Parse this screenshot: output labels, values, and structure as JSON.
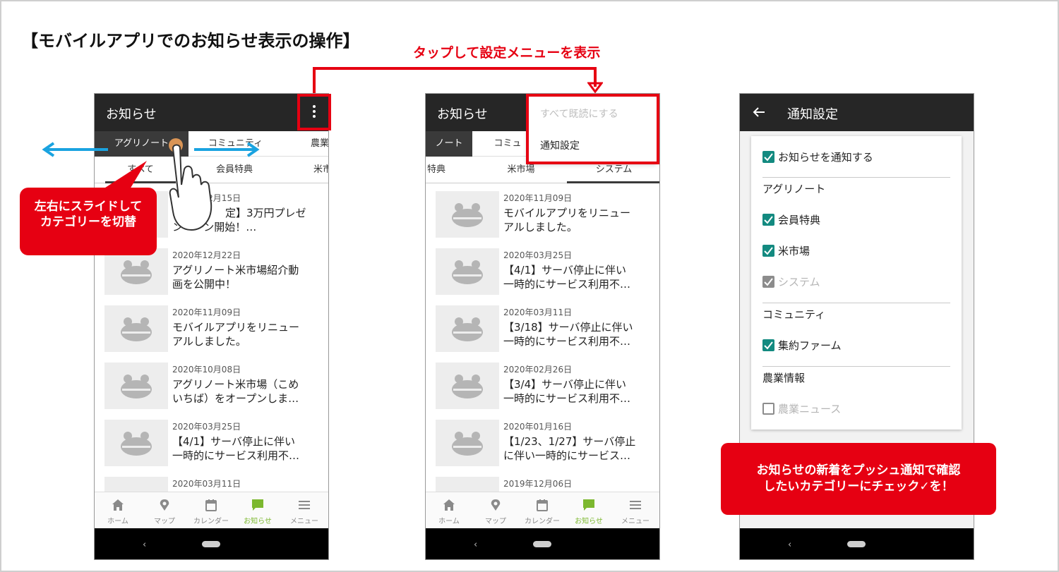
{
  "page": {
    "title": "【モバイルアプリでのお知らせ表示の操作】",
    "tap_label": "タップして設定メニューを表示"
  },
  "phone1": {
    "title": "お知らせ",
    "tabs": [
      "アグリノート",
      "コミュニティ",
      "農業"
    ],
    "subtabs": [
      "すべて",
      "会員特典",
      "米市"
    ],
    "items": [
      {
        "date": "2020年12月15日",
        "title": "【　　　　定】3万円プレゼ\nンペーン開始！…"
      },
      {
        "date": "2020年12月22日",
        "title": "アグリノート米市場紹介動\n画を公開中！"
      },
      {
        "date": "2020年11月09日",
        "title": "モバイルアプリをリニュー\nアルしました。"
      },
      {
        "date": "2020年10月08日",
        "title": "アグリノート米市場（こめ\nいちば）をオープンしま…"
      },
      {
        "date": "2020年03月25日",
        "title": "【4/1】サーバ停止に伴い\n一時的にサービス利用不…"
      },
      {
        "date": "2020年03月11日",
        "title": ""
      }
    ],
    "callout": {
      "line1": "左右にスライドして",
      "line2": "カテゴリーを切替"
    }
  },
  "nav": [
    "ホーム",
    "マップ",
    "カレンダー",
    "お知らせ",
    "メニュー"
  ],
  "phone2": {
    "title": "お知らせ",
    "tabs": [
      "ノート",
      "コミュ"
    ],
    "subtabs": [
      "特典",
      "米市場",
      "システム"
    ],
    "menu": {
      "mark_all_read": "すべて既読にする",
      "notify_settings": "通知設定"
    },
    "items": [
      {
        "date": "2020年11月09日",
        "title": "モバイルアプリをリニュー\nアルしました。"
      },
      {
        "date": "2020年03月25日",
        "title": "【4/1】サーバ停止に伴い\n一時的にサービス利用不…"
      },
      {
        "date": "2020年03月11日",
        "title": "【3/18】サーバ停止に伴い\n一時的にサービス利用不…"
      },
      {
        "date": "2020年02月26日",
        "title": "【3/4】サーバ停止に伴い\n一時的にサービス利用不…"
      },
      {
        "date": "2020年01月16日",
        "title": "【1/23、1/27】サーバ停止\nに伴い一時的にサービス…"
      },
      {
        "date": "2019年12月06日",
        "title": ""
      }
    ]
  },
  "phone3": {
    "title": "通知設定",
    "master": "お知らせを通知する",
    "sections": [
      {
        "name": "アグリノート",
        "options": [
          {
            "label": "会員特典",
            "state": "checked"
          },
          {
            "label": "米市場",
            "state": "checked"
          },
          {
            "label": "システム",
            "state": "disabled-checked"
          }
        ]
      },
      {
        "name": "コミュニティ",
        "options": [
          {
            "label": "集約ファーム",
            "state": "checked"
          }
        ]
      },
      {
        "name": "農業情報",
        "options": [
          {
            "label": "農業ニュース",
            "state": "disabled-unchecked"
          }
        ]
      }
    ],
    "callout": {
      "line1": "お知らせの新着をプッシュ通知で確認",
      "line2": "したいカテゴリーにチェック✓を！"
    }
  },
  "colors": {
    "accent_red": "#e60012",
    "checkbox_green": "#138a80",
    "nav_active": "#7cb82f",
    "arrow_blue": "#1aa3e0"
  }
}
